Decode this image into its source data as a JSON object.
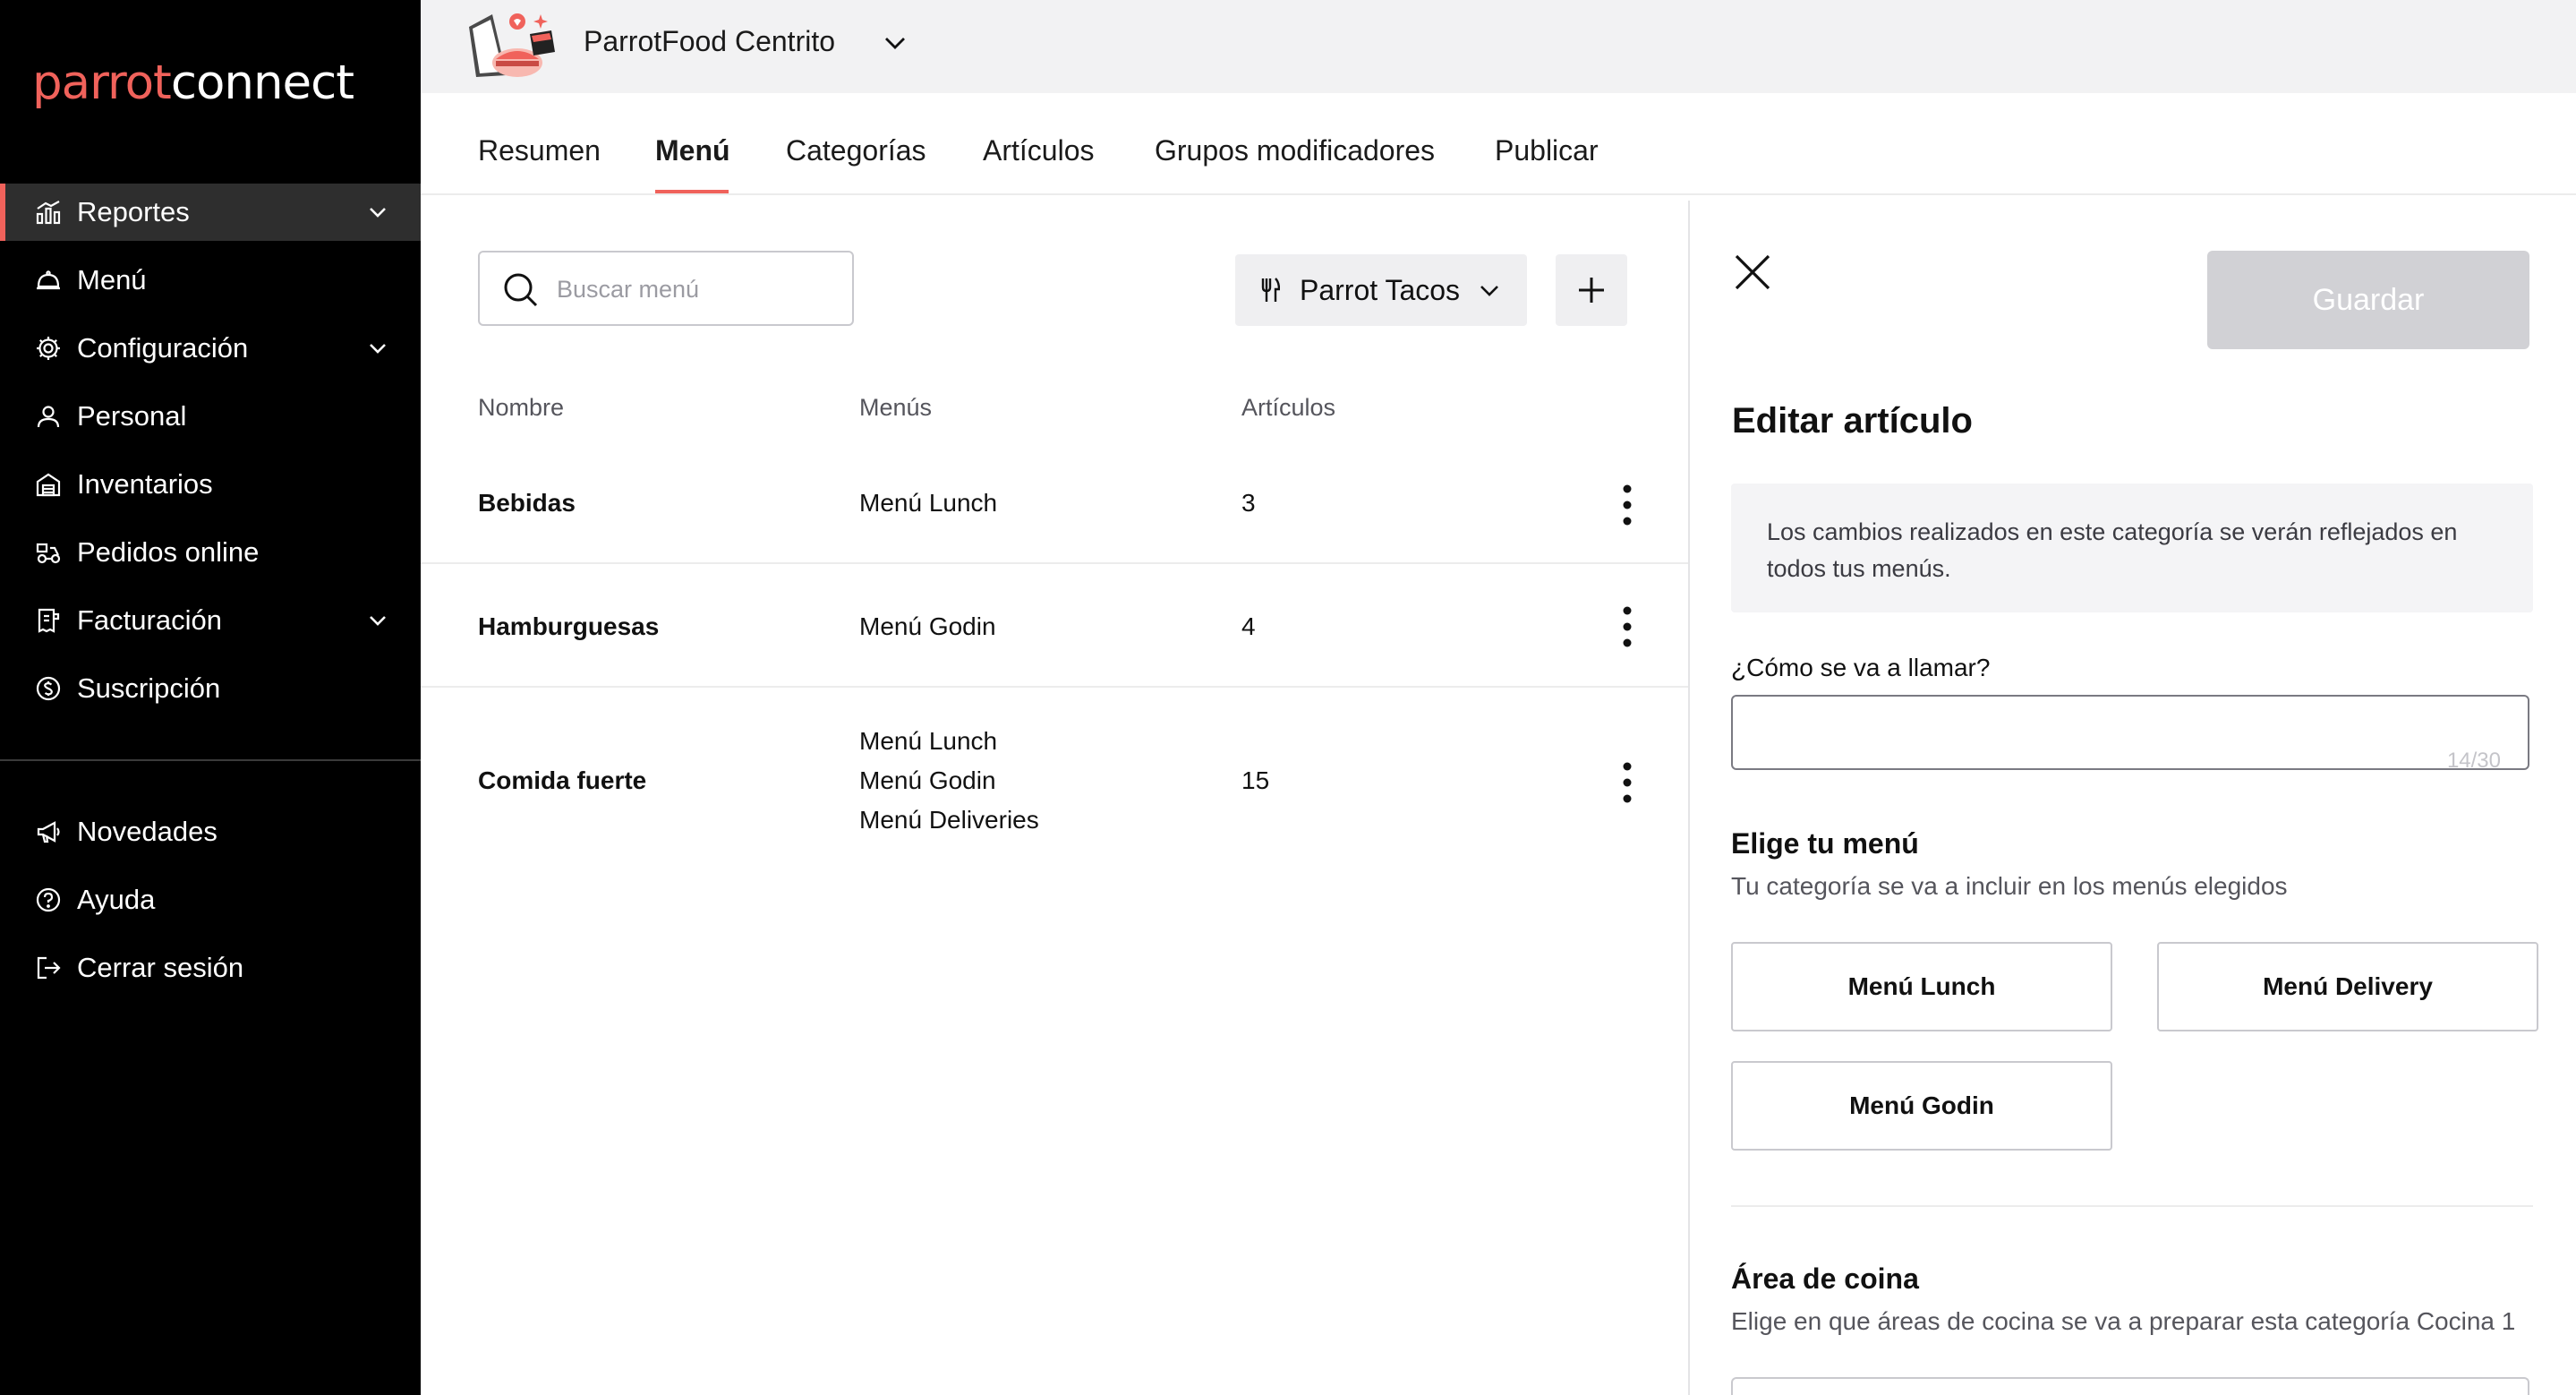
{
  "sidebar": {
    "logo": {
      "part1": "parrot",
      "part2": "connect"
    },
    "items": [
      {
        "label": "Reportes",
        "icon": "bar-chart-icon",
        "has_chevron": true,
        "active": true
      },
      {
        "label": "Menú",
        "icon": "cloche-icon",
        "has_chevron": false
      },
      {
        "label": "Configuración",
        "icon": "gear-icon",
        "has_chevron": true
      },
      {
        "label": "Personal",
        "icon": "person-icon",
        "has_chevron": false
      },
      {
        "label": "Inventarios",
        "icon": "warehouse-icon",
        "has_chevron": false
      },
      {
        "label": "Pedidos online",
        "icon": "delivery-icon",
        "has_chevron": false
      },
      {
        "label": "Facturación",
        "icon": "invoice-icon",
        "has_chevron": true
      },
      {
        "label": "Suscripción",
        "icon": "subscription-icon",
        "has_chevron": false
      }
    ],
    "secondary": [
      {
        "label": "Novedades",
        "icon": "megaphone-icon"
      },
      {
        "label": "Ayuda",
        "icon": "help-icon"
      },
      {
        "label": "Cerrar sesión",
        "icon": "logout-icon"
      }
    ]
  },
  "topbar": {
    "store_name": "ParrotFood Centrito"
  },
  "tabs": [
    {
      "label": "Resumen"
    },
    {
      "label": "Menú",
      "active": true
    },
    {
      "label": "Categorías"
    },
    {
      "label": "Artículos"
    },
    {
      "label": "Grupos modificadores"
    },
    {
      "label": "Publicar"
    }
  ],
  "toolbar": {
    "search_placeholder": "Buscar menú",
    "brand": "Parrot Tacos"
  },
  "table": {
    "headers": [
      "Nombre",
      "Menús",
      "Artículos"
    ],
    "rows": [
      {
        "name": "Bebidas",
        "menus": [
          "Menú Lunch"
        ],
        "count": "3"
      },
      {
        "name": "Hamburguesas",
        "menus": [
          "Menú Godin"
        ],
        "count": "4"
      },
      {
        "name": "Comida fuerte",
        "menus": [
          "Menú Lunch",
          "Menú Godin",
          "Menú Deliveries"
        ],
        "count": "15"
      }
    ]
  },
  "panel": {
    "save_label": "Guardar",
    "title": "Editar artículo",
    "info": "Los cambios realizados en este categoría se verán reflejados en todos tus menús.",
    "name_label": "¿Cómo se va a llamar?",
    "name_value": "",
    "name_counter": "14/30",
    "menu_section_title": "Elige tu menú",
    "menu_section_sub": "Tu categoría se va a incluir en los menús elegidos",
    "menu_options": [
      "Menú Lunch",
      "Menú Delivery",
      "Menú Godin"
    ],
    "area_title": "Área de coina",
    "area_sub": "Elige en que áreas de cocina se va a preparar esta categoría Cocina 1"
  },
  "colors": {
    "accent": "#f0625b",
    "sidebar_bg": "#000000",
    "topbar_bg": "#f2f2f3",
    "save_disabled": "#d1d1d5"
  }
}
